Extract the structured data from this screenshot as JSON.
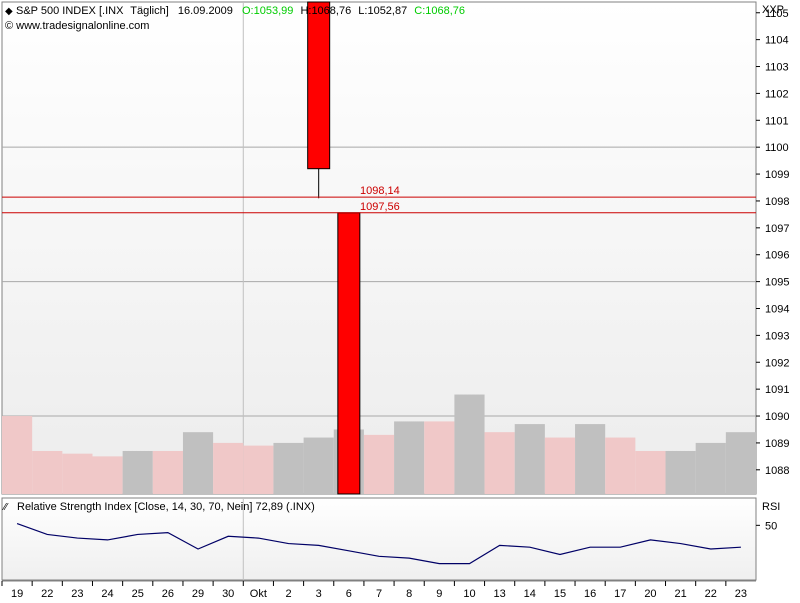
{
  "header": {
    "symbol": "S&P 500 INDEX [.INX",
    "period": "Täglich]",
    "date": "16.09.2009",
    "open_label": "O:",
    "open": "1053,99",
    "high_label": "H:",
    "high": "1068,76",
    "low_label": "L:",
    "low": "1052,87",
    "close_label": "C:",
    "close": "1068,76",
    "source": "© www.tradesignalonline.com",
    "exchange": "XXP",
    "colors": {
      "open": "#00cc00",
      "close": "#00cc00",
      "text": "#000000"
    }
  },
  "chart_data": [
    {
      "type": "bar",
      "title": "S&P 500 INDEX [.INX Täglich]",
      "ylabel": "XXP",
      "ylim": [
        1087.1,
        1105.4
      ],
      "yticks": [
        1088,
        1089,
        1090,
        1091,
        1092,
        1093,
        1094,
        1095,
        1096,
        1097,
        1098,
        1099,
        1100,
        1101,
        1102,
        1103,
        1104,
        1105
      ],
      "categories": [
        "19",
        "22",
        "23",
        "24",
        "25",
        "26",
        "29",
        "30",
        "Okt",
        "2",
        "3",
        "6",
        "7",
        "8",
        "9",
        "10",
        "13",
        "14",
        "15",
        "16",
        "17",
        "20",
        "21",
        "22",
        "23"
      ],
      "volume_bars": {
        "values": [
          1090.0,
          1088.7,
          1088.6,
          1088.5,
          1088.7,
          1088.7,
          1089.4,
          1089.0,
          1088.9,
          1089.0,
          1089.2,
          1089.5,
          1089.3,
          1089.8,
          1089.8,
          1090.8,
          1089.4,
          1089.7,
          1089.2,
          1089.7,
          1089.2,
          1088.7,
          1088.7,
          1089.0,
          1089.4
        ],
        "colors": [
          "pink",
          "pink",
          "pink",
          "pink",
          "gray",
          "pink",
          "gray",
          "pink",
          "pink",
          "gray",
          "gray",
          "gray",
          "pink",
          "gray",
          "pink",
          "gray",
          "pink",
          "gray",
          "pink",
          "gray",
          "pink",
          "pink",
          "gray",
          "gray",
          "gray"
        ]
      },
      "candles": [
        {
          "category_index": 10,
          "open": 1099.2,
          "close": 1106.0,
          "high": 1106.0,
          "low": 1098.1,
          "color": "#ff0000"
        },
        {
          "category_index": 11,
          "open": 1097.56,
          "close": 1087.1,
          "high": 1097.56,
          "low": 1087.1,
          "color": "#ff0000"
        }
      ],
      "price_lines": [
        {
          "value": 1098.14,
          "label": "1098,14",
          "color": "#cc0000"
        },
        {
          "value": 1097.56,
          "label": "1097,56",
          "color": "#cc0000"
        }
      ],
      "grid_major": [
        1090,
        1095,
        1100
      ],
      "vertical_grid_after": "30",
      "colors": {
        "volume_pink": "#f0c8c8",
        "volume_gray": "#c0c0c0",
        "candle": "#ff0000",
        "grid": "#999999"
      }
    },
    {
      "type": "line",
      "title": "Relative Strength Index [Close, 14, 30, 70, Nein] 72,89 (.INX)",
      "ylabel": "RSI",
      "ylim": [
        20,
        65
      ],
      "yticks": [
        50
      ],
      "series": [
        {
          "name": "Relative Strength Index",
          "values": [
            51,
            45,
            43,
            42,
            45,
            46,
            37,
            44,
            43,
            40,
            39,
            36,
            33,
            32,
            29,
            29,
            39,
            38,
            34,
            38,
            38,
            42,
            40,
            37,
            38
          ],
          "color": "#000066"
        }
      ]
    }
  ],
  "rsi_header": {
    "label": "Relative Strength Index [Close, 14, 30, 70, Nein] 72,89 (.INX)",
    "axis_label": "RSI"
  }
}
